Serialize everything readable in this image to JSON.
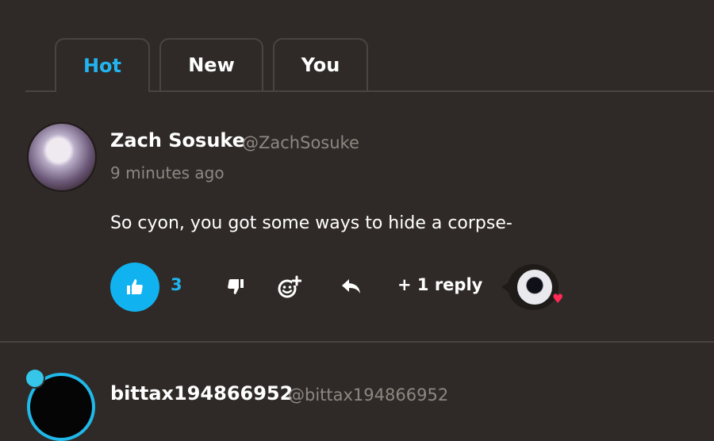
{
  "tabs": [
    {
      "label": "Hot",
      "active": true
    },
    {
      "label": "New",
      "active": false
    },
    {
      "label": "You",
      "active": false
    }
  ],
  "comment": {
    "author_name": "Zach Sosuke",
    "author_handle": "@ZachSosuke",
    "timestamp": "9 minutes ago",
    "body": "So cyon, you got some ways to hide a corpse-",
    "like_count": "3",
    "replies_label": "+ 1 reply",
    "reaction": "heart"
  },
  "next_comment": {
    "author_name": "bittax194866952",
    "author_handle": "@bittax194866952"
  },
  "icons": [
    "thumbs-up-icon",
    "thumbs-down-icon",
    "add-emoji-icon",
    "reply-arrow-icon",
    "heart-icon"
  ],
  "colors": {
    "background": "#2f2a27",
    "accent": "#11b2f0",
    "muted_text": "#8e8782",
    "heart": "#ff2a55"
  }
}
